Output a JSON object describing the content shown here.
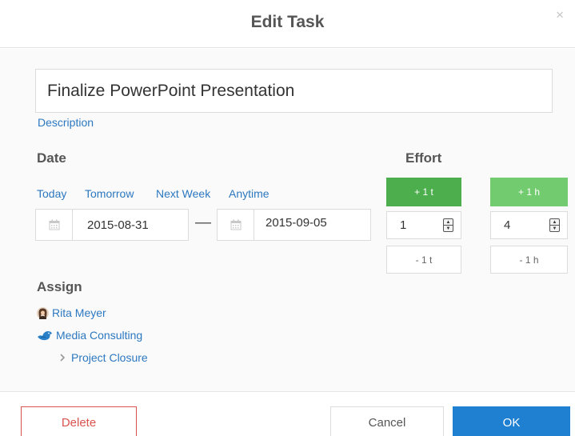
{
  "dialog": {
    "title": "Edit Task",
    "close_glyph": "×"
  },
  "task": {
    "name": "Finalize PowerPoint Presentation",
    "description_link": "Description"
  },
  "date": {
    "heading": "Date",
    "quick_options": [
      "Today",
      "Tomorrow",
      "Next Week",
      "Anytime"
    ],
    "start": "2015-08-31",
    "end": "2015-09-05",
    "separator": "—"
  },
  "effort": {
    "heading": "Effort",
    "tasks": {
      "plus_label": "+ 1 t",
      "value": "1",
      "minus_label": "- 1 t",
      "accent": "#4cae4c"
    },
    "hours": {
      "plus_label": "+ 1 h",
      "value": "4",
      "minus_label": "- 1 h",
      "accent": "#72cc6f"
    }
  },
  "assign": {
    "heading": "Assign",
    "person": "Rita Meyer",
    "organization": "Media Consulting",
    "project": "Project Closure"
  },
  "footer": {
    "delete_label": "Delete",
    "cancel_label": "Cancel",
    "ok_label": "OK"
  },
  "colors": {
    "link": "#2c78c0",
    "danger": "#d9534f",
    "primary": "#1f7fd1"
  },
  "icons": {
    "start_date": "calendar-icon",
    "end_date": "calendar-icon",
    "person": "user-avatar-icon",
    "organization": "bird-logo-icon",
    "project": "chevron-right-icon"
  }
}
